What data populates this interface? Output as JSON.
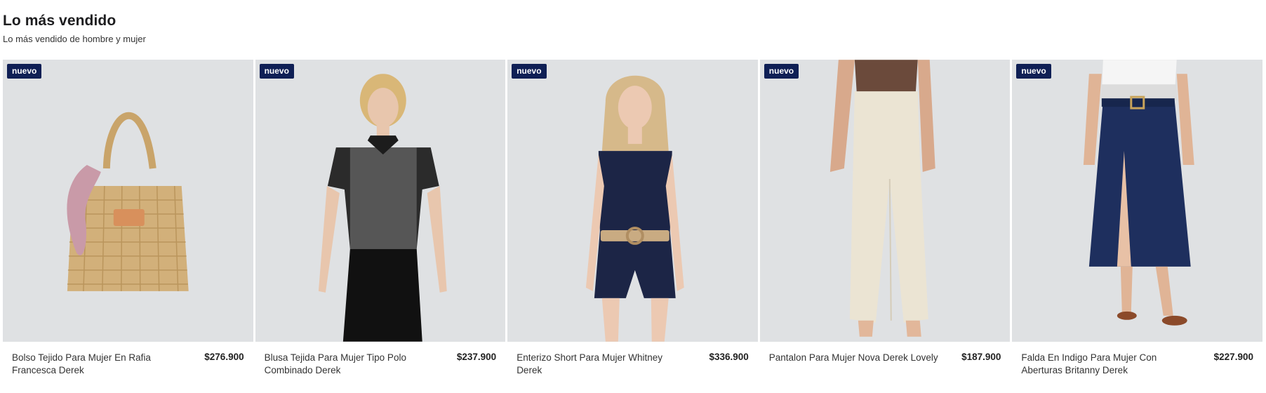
{
  "section": {
    "title": "Lo más vendido",
    "subtitle": "Lo más vendido de hombre y mujer"
  },
  "products": [
    {
      "badge": "nuevo",
      "name": "Bolso Tejido Para Mujer En Rafia Francesca Derek",
      "price": "$276.900",
      "image_icon": "woven-tote-bag-icon"
    },
    {
      "badge": "nuevo",
      "name": "Blusa Tejida Para Mujer Tipo Polo Combinado Derek",
      "price": "$237.900",
      "image_icon": "polo-blouse-model-icon"
    },
    {
      "badge": "nuevo",
      "name": "Enterizo Short Para Mujer Whitney Derek",
      "price": "$336.900",
      "image_icon": "romper-model-icon"
    },
    {
      "badge": "nuevo",
      "name": "Pantalon Para Mujer Nova Derek Lovely",
      "price": "$187.900",
      "image_icon": "cream-trousers-model-icon"
    },
    {
      "badge": "nuevo",
      "name": "Falda En Indigo Para Mujer Con Aberturas Britanny Derek",
      "price": "$227.900",
      "image_icon": "denim-skirt-model-icon"
    }
  ],
  "colors": {
    "badge_bg": "#0f1f55",
    "image_bg": "#dfe1e3"
  }
}
